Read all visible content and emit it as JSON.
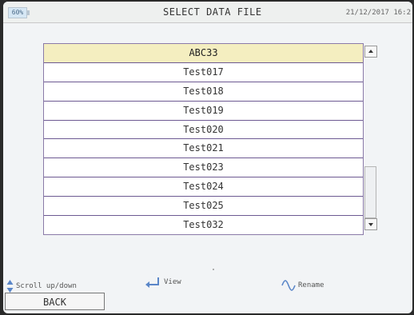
{
  "header": {
    "battery": "60%",
    "title": "SELECT DATA FILE",
    "datetime": "21/12/2017 16:2"
  },
  "files": [
    "ABC33",
    "Test017",
    "Test018",
    "Test019",
    "Test020",
    "Test021",
    "Test023",
    "Test024",
    "Test025",
    "Test032"
  ],
  "selected_index": 0,
  "hints": {
    "scroll": "Scroll up/down",
    "view": "View",
    "rename": "Rename"
  },
  "back_label": "BACK",
  "colors": {
    "selected_row": "#f4eec0",
    "row_border": "#6d5a92",
    "background": "#f2f4f6"
  }
}
